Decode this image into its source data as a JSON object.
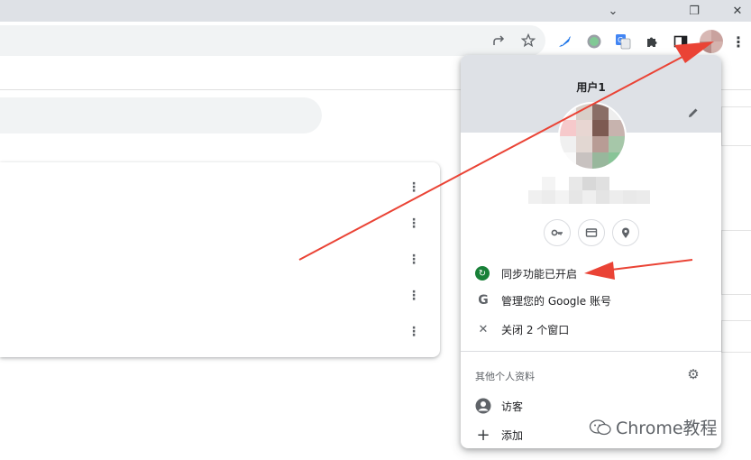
{
  "window": {
    "controls": {
      "tab_search": "⌄",
      "restore": "❐",
      "close": "✕"
    }
  },
  "toolbar": {
    "share_icon": "share-icon",
    "bookmark_icon": "star-icon",
    "extensions": [
      "feather-extension-icon",
      "circle-extension-icon",
      "translate-extension-icon",
      "puzzle-extensions-icon"
    ],
    "side_panel_icon": "side-panel-icon",
    "menu_icon": "more-vert-icon"
  },
  "page": {
    "card_row_count": 5,
    "kebab_glyph": "⋮"
  },
  "profile_popup": {
    "title": "用户1",
    "edit_icon": "pencil-icon",
    "quick_actions": [
      {
        "name": "password-key-icon",
        "glyph": "⚿"
      },
      {
        "name": "payment-card-icon",
        "glyph": "▭"
      },
      {
        "name": "location-pin-icon",
        "glyph": "⬤"
      }
    ],
    "menu_items": [
      {
        "icon": "sync-icon",
        "glyph": "↻",
        "label": "同步功能已开启"
      },
      {
        "icon": "google-g-icon",
        "glyph": "G",
        "label": "管理您的 Google 账号"
      },
      {
        "icon": "close-icon",
        "glyph": "✕",
        "label": "关闭 2 个窗口"
      }
    ],
    "other_profiles_label": "其他个人资料",
    "other_profiles_gear": "⚙",
    "guest": {
      "glyph": "●",
      "label": "访客"
    },
    "add": {
      "glyph": "+",
      "label": "添加"
    }
  },
  "annotations": {
    "arrow_color": "#ea4335"
  },
  "watermark": {
    "text": "Chrome教程"
  },
  "colors": {
    "header_bg": "#dee1e6",
    "sync_green": "#188038",
    "icon_gray": "#5f6368"
  }
}
